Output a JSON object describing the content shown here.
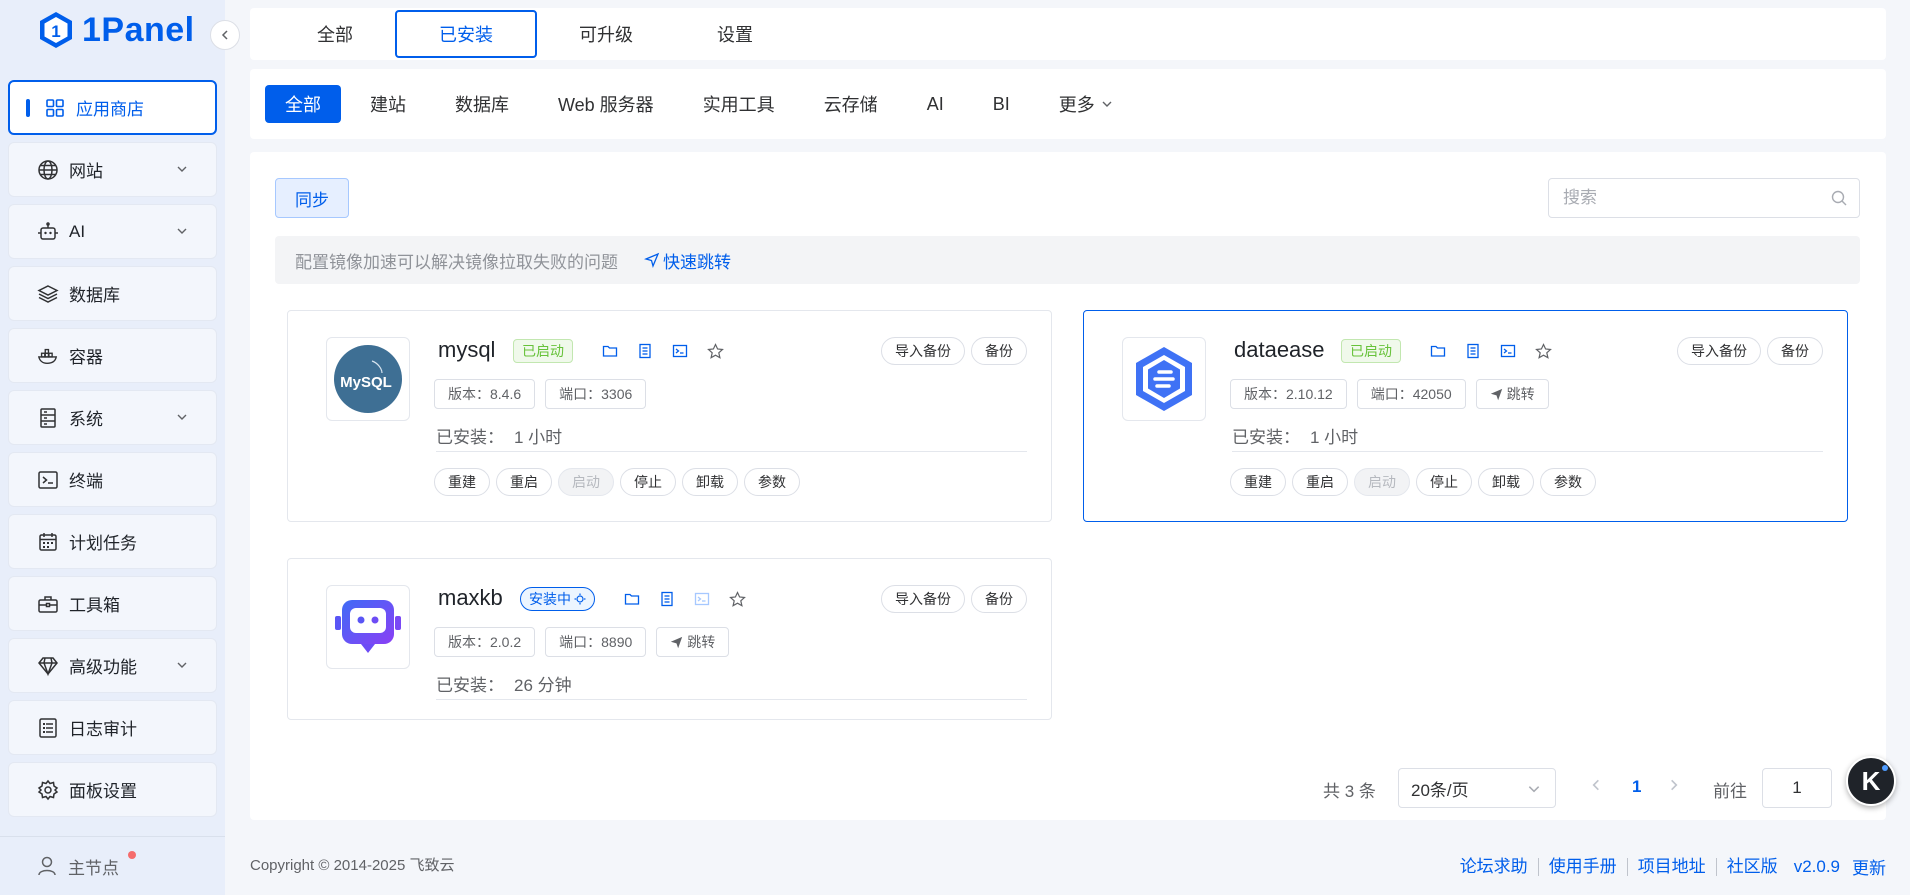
{
  "brand": {
    "name": "1Panel"
  },
  "sidebar": {
    "items": [
      {
        "label": "应用商店",
        "icon": "grid-icon",
        "active": true
      },
      {
        "label": "网站",
        "icon": "globe-icon",
        "expandable": true
      },
      {
        "label": "AI",
        "icon": "robot-icon",
        "expandable": true
      },
      {
        "label": "数据库",
        "icon": "layers-icon"
      },
      {
        "label": "容器",
        "icon": "container-icon"
      },
      {
        "label": "系统",
        "icon": "server-icon",
        "expandable": true
      },
      {
        "label": "终端",
        "icon": "terminal-icon"
      },
      {
        "label": "计划任务",
        "icon": "calendar-icon"
      },
      {
        "label": "工具箱",
        "icon": "toolbox-icon"
      },
      {
        "label": "高级功能",
        "icon": "diamond-icon",
        "expandable": true
      },
      {
        "label": "日志审计",
        "icon": "log-icon"
      },
      {
        "label": "面板设置",
        "icon": "gear-icon"
      }
    ],
    "node": {
      "label": "主节点",
      "icon": "user-icon"
    }
  },
  "tabs": [
    "全部",
    "已安装",
    "可升级",
    "设置"
  ],
  "active_tab": "已安装",
  "categories": [
    "全部",
    "建站",
    "数据库",
    "Web 服务器",
    "实用工具",
    "云存储",
    "AI",
    "BI",
    "更多"
  ],
  "active_category": "全部",
  "toolbar": {
    "sync_label": "同步",
    "search_placeholder": "搜索"
  },
  "notice": {
    "text": "配置镜像加速可以解决镜像拉取失败的问题",
    "link": "快速跳转"
  },
  "common": {
    "import_backup": "导入备份",
    "backup": "备份",
    "jump": "跳转",
    "installed_label": "已安装：",
    "actions": [
      "重建",
      "重启",
      "启动",
      "停止",
      "卸载",
      "参数"
    ]
  },
  "apps": [
    {
      "name": "mysql",
      "status": "已启动",
      "version": "版本：8.4.6",
      "port": "端口：3306",
      "installed": "1 小时",
      "logo_text": "MySQL"
    },
    {
      "name": "dataease",
      "status": "已启动",
      "version": "版本：2.10.12",
      "port": "端口：42050",
      "installed": "1 小时"
    },
    {
      "name": "maxkb",
      "status": "安装中",
      "version": "版本：2.0.2",
      "port": "端口：8890",
      "installed": "26 分钟"
    }
  ],
  "pagination": {
    "total": "共 3 条",
    "page_size": "20条/页",
    "current": "1",
    "goto_label": "前往",
    "goto_value": "1"
  },
  "float_button": {
    "label": "K"
  },
  "footer": {
    "copyright": "Copyright © 2014-2025 飞致云",
    "links": [
      "论坛求助",
      "使用手册",
      "项目地址",
      "社区版"
    ],
    "version": "v2.0.9",
    "update": "更新"
  },
  "colors": {
    "primary": "#005eeb",
    "success": "#67c23a",
    "sidebar_bg": "#e8eefa"
  }
}
